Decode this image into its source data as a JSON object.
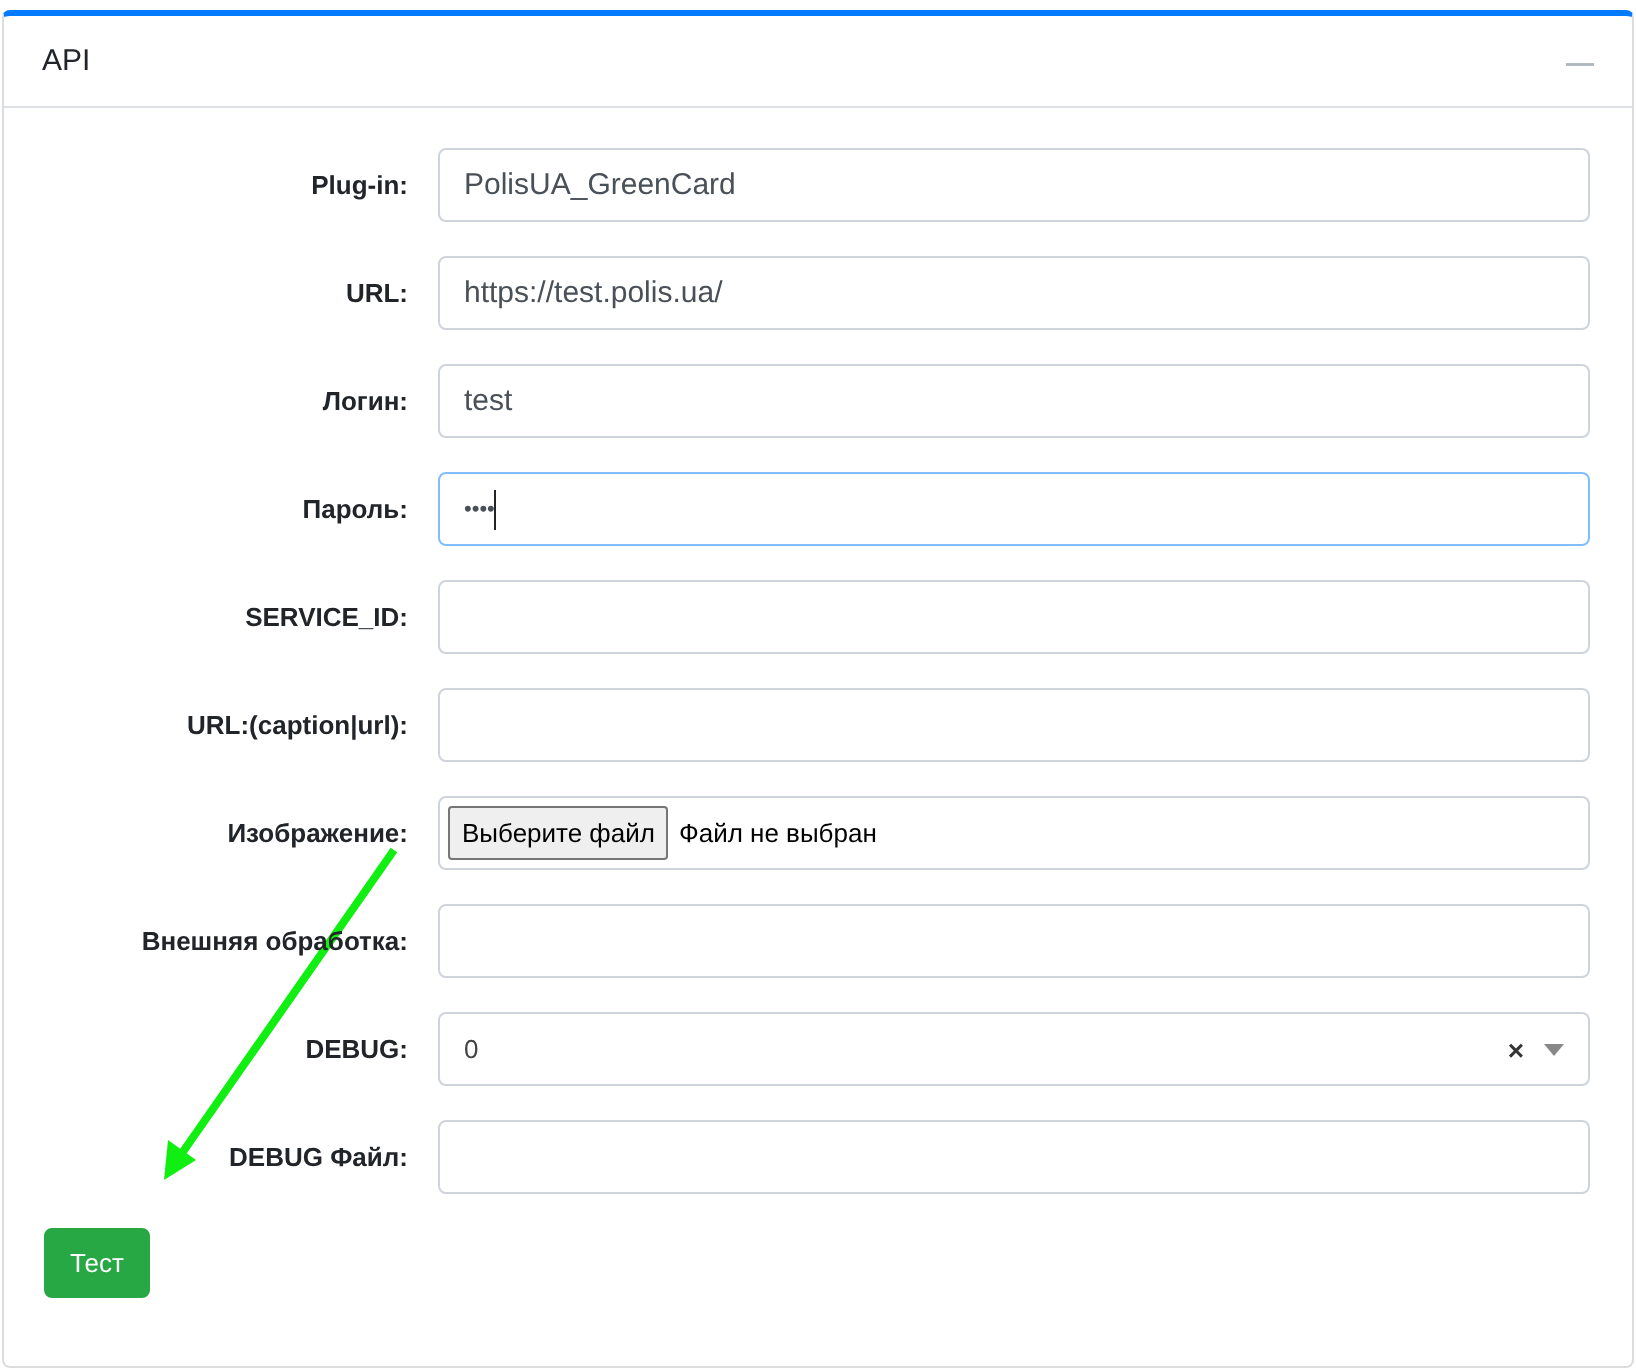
{
  "panel": {
    "title": "API",
    "collapse_icon": "—"
  },
  "fields": [
    {
      "kind": "text",
      "label": "Plug-in:",
      "value": "PolisUA_GreenCard",
      "focused": false
    },
    {
      "kind": "text",
      "label": "URL:",
      "value": "https://test.polis.ua/",
      "focused": false
    },
    {
      "kind": "text",
      "label": "Логин:",
      "value": "test",
      "focused": false
    },
    {
      "kind": "password",
      "label": "Пароль:",
      "value": "••••",
      "focused": true
    },
    {
      "kind": "text",
      "label": "SERVICE_ID:",
      "focused": false
    },
    {
      "kind": "text",
      "label": "URL:(caption|url):",
      "focused": false
    },
    {
      "kind": "file",
      "label": "Изображение:",
      "button": "Выберите файл",
      "status": "Файл не выбран",
      "focused": false
    },
    {
      "kind": "text",
      "label": "Внешняя обработка:",
      "focused": false
    },
    {
      "kind": "select",
      "label": "DEBUG:",
      "value": "0",
      "clear": "×",
      "focused": false
    },
    {
      "kind": "text",
      "label": "DEBUG Файл:",
      "focused": false
    }
  ],
  "test_button": "Тест"
}
